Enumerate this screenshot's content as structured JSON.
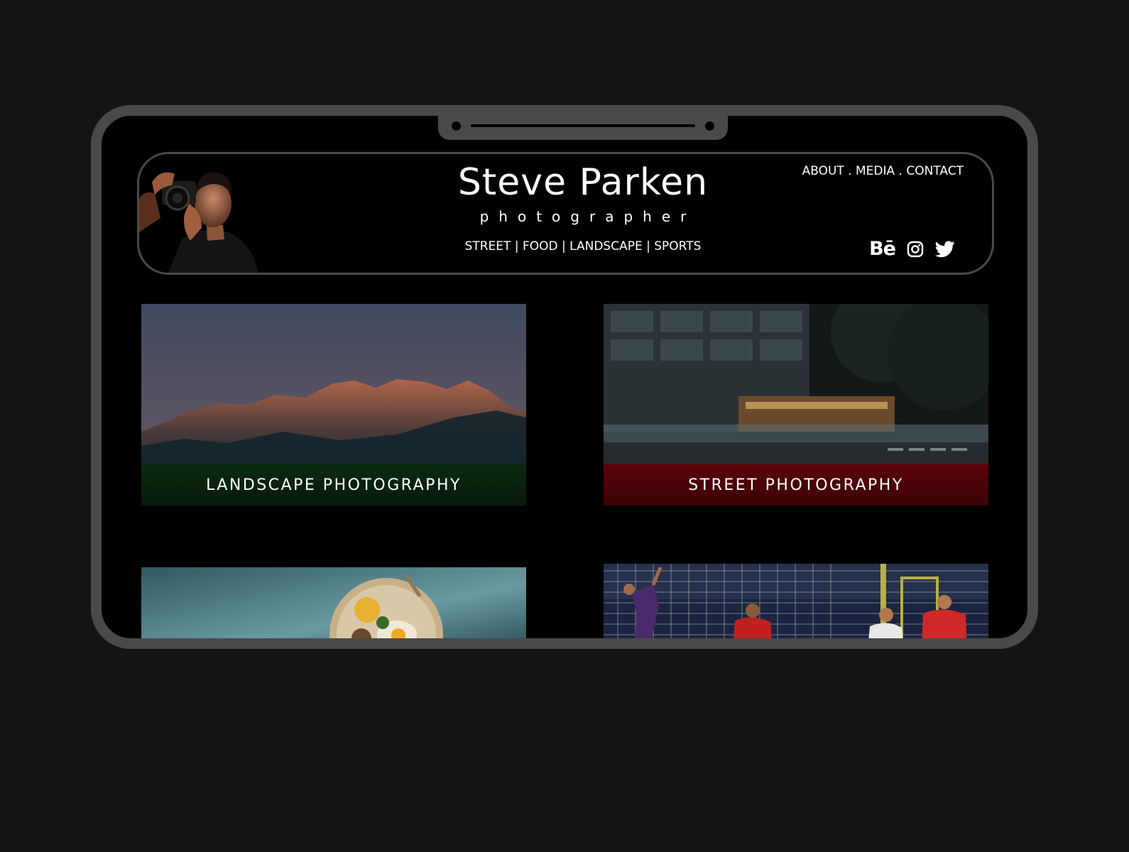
{
  "header": {
    "title": "Steve Parken",
    "subtitle": "photographer",
    "categories": "STREET | FOOD | LANDSCAPE | SPORTS",
    "nav": {
      "about": "ABOUT",
      "sep1": " . ",
      "media": "MEDIA",
      "sep2": " . ",
      "contact": "CONTACT"
    },
    "social": {
      "behance_label": "Bē",
      "icons": [
        "behance-icon",
        "instagram-icon",
        "twitter-icon"
      ]
    }
  },
  "gallery": [
    {
      "caption": "LANDSCAPE PHOTOGRAPHY",
      "caption_color": "#0b2a12"
    },
    {
      "caption": "STREET PHOTOGRAPHY",
      "caption_color": "#5a0409"
    },
    {
      "caption": ""
    },
    {
      "caption": ""
    }
  ],
  "colors": {
    "page_background": "#141414",
    "device_frame": "#4a4a4a",
    "screen": "#000000",
    "text": "#ffffff"
  }
}
